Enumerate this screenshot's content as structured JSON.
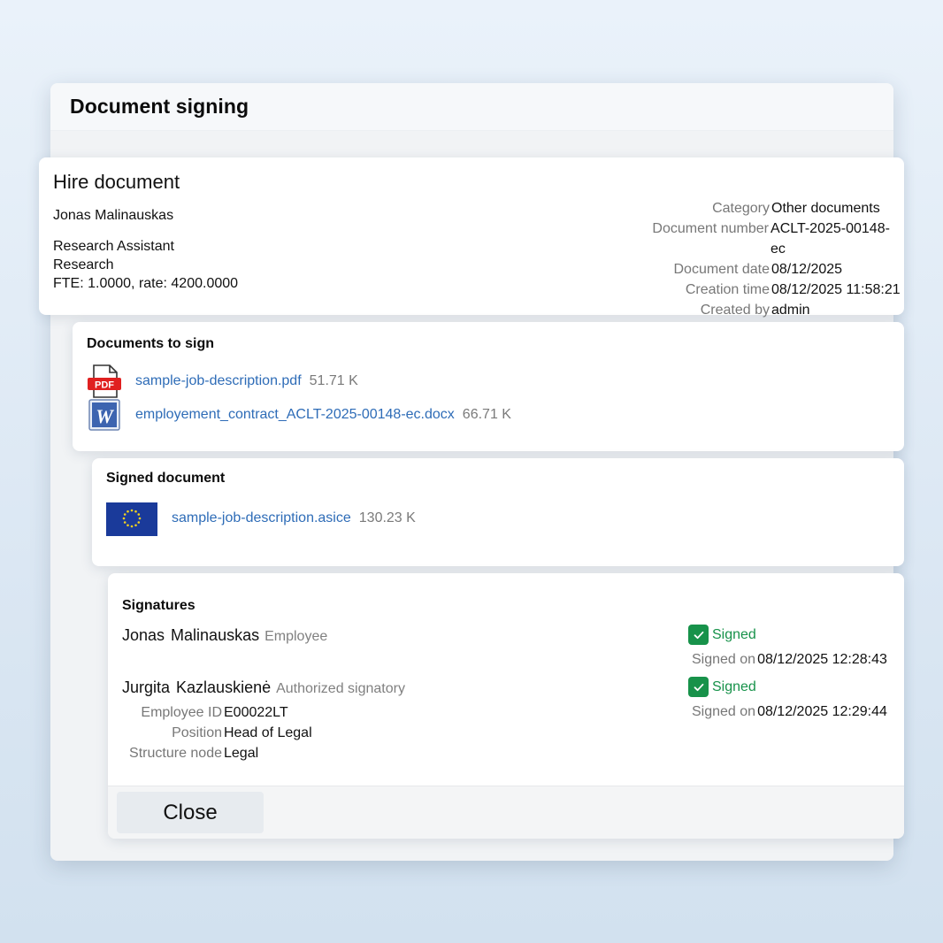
{
  "dialog": {
    "title": "Document signing"
  },
  "hire": {
    "title": "Hire document",
    "employee": "Jonas Malinauskas",
    "position": "Research Assistant",
    "department": "Research",
    "fte": "FTE: 1.0000, rate: 4200.0000",
    "meta": [
      {
        "key": "Category",
        "value": "Other documents"
      },
      {
        "key": "Document number",
        "value": "ACLT-2025-00148-ec"
      },
      {
        "key": "Document date",
        "value": "08/12/2025"
      },
      {
        "key": "Creation time",
        "value": "08/12/2025 11:58:21"
      },
      {
        "key": "Created by",
        "value": "admin"
      }
    ]
  },
  "docs": {
    "title": "Documents to sign",
    "files": [
      {
        "icon": "pdf-file-icon",
        "name": "sample-job-description.pdf",
        "size": "51.71 K"
      },
      {
        "icon": "word-file-icon",
        "name": "employement_contract_ACLT-2025-00148-ec.docx",
        "size": "66.71 K"
      }
    ]
  },
  "signed": {
    "title": "Signed document",
    "file": {
      "icon": "eu-flag-icon",
      "name": "sample-job-description.asice",
      "size": "130.23 K"
    }
  },
  "signatures": {
    "title": "Signatures",
    "items": [
      {
        "first": "Jonas",
        "last": "Malinauskas",
        "role": "Employee",
        "status": "Signed",
        "signed_on_label": "Signed on",
        "signed_on": "08/12/2025 12:28:43"
      },
      {
        "first": "Jurgita",
        "last": "Kazlauskienė",
        "role": "Authorized signatory",
        "status": "Signed",
        "signed_on_label": "Signed on",
        "signed_on": "08/12/2025 12:29:44",
        "details": [
          {
            "key": "Employee ID",
            "value": "E00022LT"
          },
          {
            "key": "Position",
            "value": "Head of Legal"
          },
          {
            "key": "Structure node",
            "value": "Legal"
          }
        ]
      }
    ]
  },
  "footer": {
    "close_label": "Close"
  },
  "colors": {
    "link": "#2e6cb7",
    "signed": "#17924a",
    "muted": "#777777"
  }
}
